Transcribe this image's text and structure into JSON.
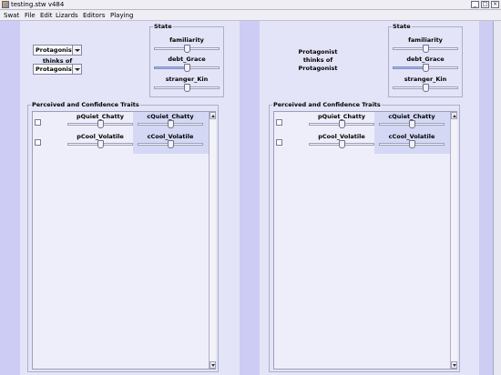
{
  "window": {
    "title": "testing.stw v484",
    "minimize": "_",
    "maximize": "□",
    "close": "×"
  },
  "menu": [
    {
      "label": "Swat"
    },
    {
      "label": "File"
    },
    {
      "label": "Edit"
    },
    {
      "label": "Lizards"
    },
    {
      "label": "Editors"
    },
    {
      "label": "Playing"
    }
  ],
  "left": {
    "subject": "Protagonist",
    "thinks_of": "thinks of",
    "object": "Protagonist",
    "state": {
      "title": "State",
      "sliders": [
        {
          "label": "familiarity",
          "value": 0.5
        },
        {
          "label": "debt_Grace",
          "value": 0.5
        },
        {
          "label": "stranger_Kin",
          "value": 0.5
        }
      ]
    },
    "traits": {
      "title": "Perceived and Confidence Traits",
      "rows": [
        {
          "p": {
            "label": "pQuiet_Chatty",
            "value": 0.5
          },
          "c": {
            "label": "cQuiet_Chatty",
            "value": 0.5
          }
        },
        {
          "p": {
            "label": "pCool_Volatile",
            "value": 0.5
          },
          "c": {
            "label": "cCool_Volatile",
            "value": 0.5
          }
        }
      ]
    }
  },
  "right": {
    "line1": "Protagonist",
    "line2": "thinks of",
    "line3": "Protagonist",
    "state": {
      "title": "State",
      "sliders": [
        {
          "label": "familiarity",
          "value": 0.5
        },
        {
          "label": "debt_Grace",
          "value": 0.5
        },
        {
          "label": "stranger_Kin",
          "value": 0.5
        }
      ]
    },
    "traits": {
      "title": "Perceived and Confidence Traits",
      "rows": [
        {
          "p": {
            "label": "pQuiet_Chatty",
            "value": 0.5
          },
          "c": {
            "label": "cQuiet_Chatty",
            "value": 0.5
          }
        },
        {
          "p": {
            "label": "pCool_Volatile",
            "value": 0.5
          },
          "c": {
            "label": "cCool_Volatile",
            "value": 0.5
          }
        }
      ]
    }
  },
  "colors": {
    "background": "#ccccf4",
    "panel": "#e4e4f8",
    "slider_fill": "#a8b4e4"
  }
}
